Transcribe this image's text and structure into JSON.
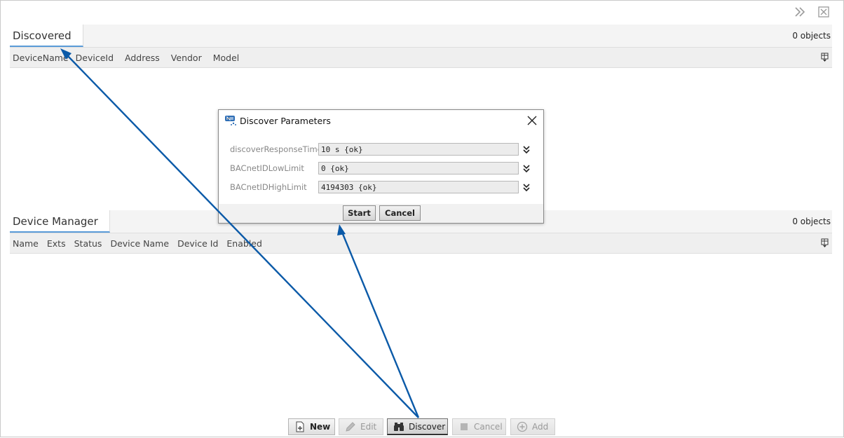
{
  "discovered": {
    "title": "Discovered",
    "count": "0 objects",
    "columns": [
      "DeviceName",
      "DeviceId",
      "Address",
      "Vendor",
      "Model"
    ]
  },
  "device_manager": {
    "title": "Device Manager",
    "count": "0 objects",
    "columns": [
      "Name",
      "Exts",
      "Status",
      "Device Name",
      "Device Id",
      "Enabled"
    ]
  },
  "dialog": {
    "title": "Discover Parameters",
    "fields": [
      {
        "label": "discoverResponseTime",
        "value": "10 s {ok}"
      },
      {
        "label": "BACnetIDLowLimit",
        "value": "0 {ok}"
      },
      {
        "label": "BACnetIDHighLimit",
        "value": "4194303 {ok}"
      }
    ],
    "start_label": "Start",
    "cancel_label": "Cancel"
  },
  "toolbar": {
    "new_label": "New",
    "edit_label": "Edit",
    "discover_label": "Discover",
    "cancel_label": "Cancel",
    "add_label": "Add"
  },
  "colors": {
    "annotation_arrow": "#0b5aa8",
    "tab_underline": "#5a9bd8"
  },
  "icons": {
    "expand": "double-chevron-right-icon",
    "close": "close-box-icon",
    "column_chooser": "column-chooser-icon"
  }
}
